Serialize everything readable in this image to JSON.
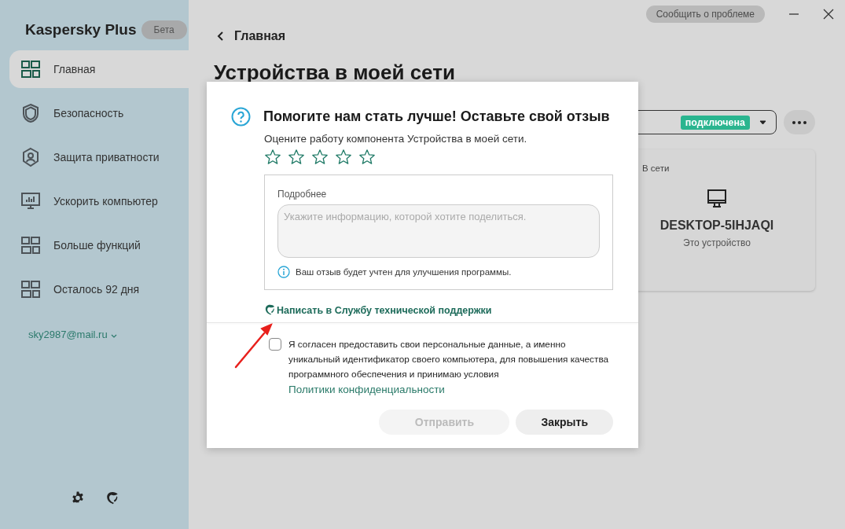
{
  "sidebar": {
    "brand": "Kaspersky Plus",
    "badge": "Бета",
    "items": [
      {
        "label": "Главная",
        "selected": true
      },
      {
        "label": "Безопасность",
        "selected": false
      },
      {
        "label": "Защита приватности",
        "selected": false
      },
      {
        "label": "Ускорить компьютер",
        "selected": false
      },
      {
        "label": "Больше функций",
        "selected": false
      },
      {
        "label": "Осталось 92 дня",
        "selected": false
      }
    ],
    "account": "sky2987@mail.ru"
  },
  "top_bar": {
    "report_button": "Сообщить о проблеме"
  },
  "back_link": "Главная",
  "page_title": "Устройства в моей сети",
  "network_selector": {
    "badge": "подключена"
  },
  "device_card": {
    "status": "В сети",
    "name": "DESKTOP-5IHJAQI",
    "subtitle": "Это устройство"
  },
  "dialog": {
    "title": "Помогите нам стать лучше! Оставьте свой отзыв",
    "prompt": "Оцените работу компонента Устройства в моей сети.",
    "stars": 0,
    "details_label": "Подробнее",
    "details_placeholder": "Укажите информацию, которой хотите поделиться.",
    "info_note": "Ваш отзыв будет учтен для улучшения программы.",
    "support_link": "Написать в Службу технической поддержки",
    "consent": {
      "checked": false,
      "text": "Я согласен предоставить свои персональные данные, а именно уникальный идентификатор своего компьютера, для повышения качества программного обеспечения и принимаю условия ",
      "link": "Политики конфиденциальности"
    },
    "buttons": [
      {
        "label": "Отправить",
        "disabled": true
      },
      {
        "label": "Закрыть",
        "disabled": false
      }
    ]
  }
}
